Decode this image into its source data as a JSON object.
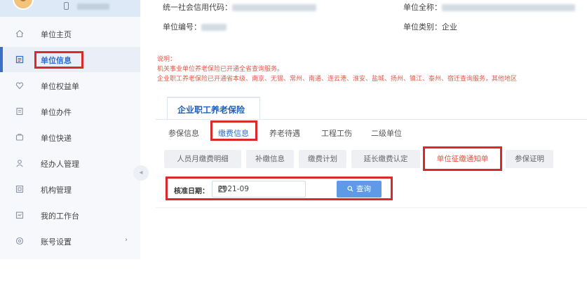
{
  "sidebar": {
    "items": [
      {
        "label": "单位主页",
        "icon": "home-icon"
      },
      {
        "label": "单位信息",
        "icon": "list-icon",
        "active": true
      },
      {
        "label": "单位权益单",
        "icon": "heart-icon"
      },
      {
        "label": "单位办件",
        "icon": "doc-icon"
      },
      {
        "label": "单位快递",
        "icon": "box-icon"
      },
      {
        "label": "经办人管理",
        "icon": "user-icon"
      },
      {
        "label": "机构管理",
        "icon": "org-icon"
      },
      {
        "label": "我的工作台",
        "icon": "desk-icon"
      },
      {
        "label": "账号设置",
        "icon": "settings-icon",
        "chevron": "›"
      }
    ],
    "collapse_glyph": "◂"
  },
  "info": {
    "credit_code_label": "统一社会信用代码：",
    "full_name_label": "单位全称：",
    "unit_no_label": "单位编号：",
    "unit_type_label": "单位类别：",
    "unit_type_value": "企业"
  },
  "notice": {
    "title": "说明：",
    "line1": "机关事业单位养老保险已开通全省查询服务。",
    "line2": "企业职工养老保险已开通省本级、南京、无锡、常州、南通、连云港、淮安、盐城、扬州、镇江、泰州、宿迁查询服务，其他地区"
  },
  "panel": {
    "title": "企业职工养老保险",
    "subtabs": [
      "参保信息",
      "缴费信息",
      "养老待遇",
      "工程工伤",
      "二级单位"
    ],
    "buttons": [
      "人员月缴费明细",
      "补缴信息",
      "缴费计划",
      "延长缴费认定",
      "单位征缴通知单",
      "参保证明"
    ],
    "filter_label": "核准日期：",
    "date_value": "2021-09",
    "search_label": "查询",
    "search_icon": "search-icon"
  },
  "colors": {
    "accent": "#2f6fd0",
    "highlight": "#d9292a",
    "notice": "#e05a4a",
    "search_button": "#5e9ae6"
  }
}
